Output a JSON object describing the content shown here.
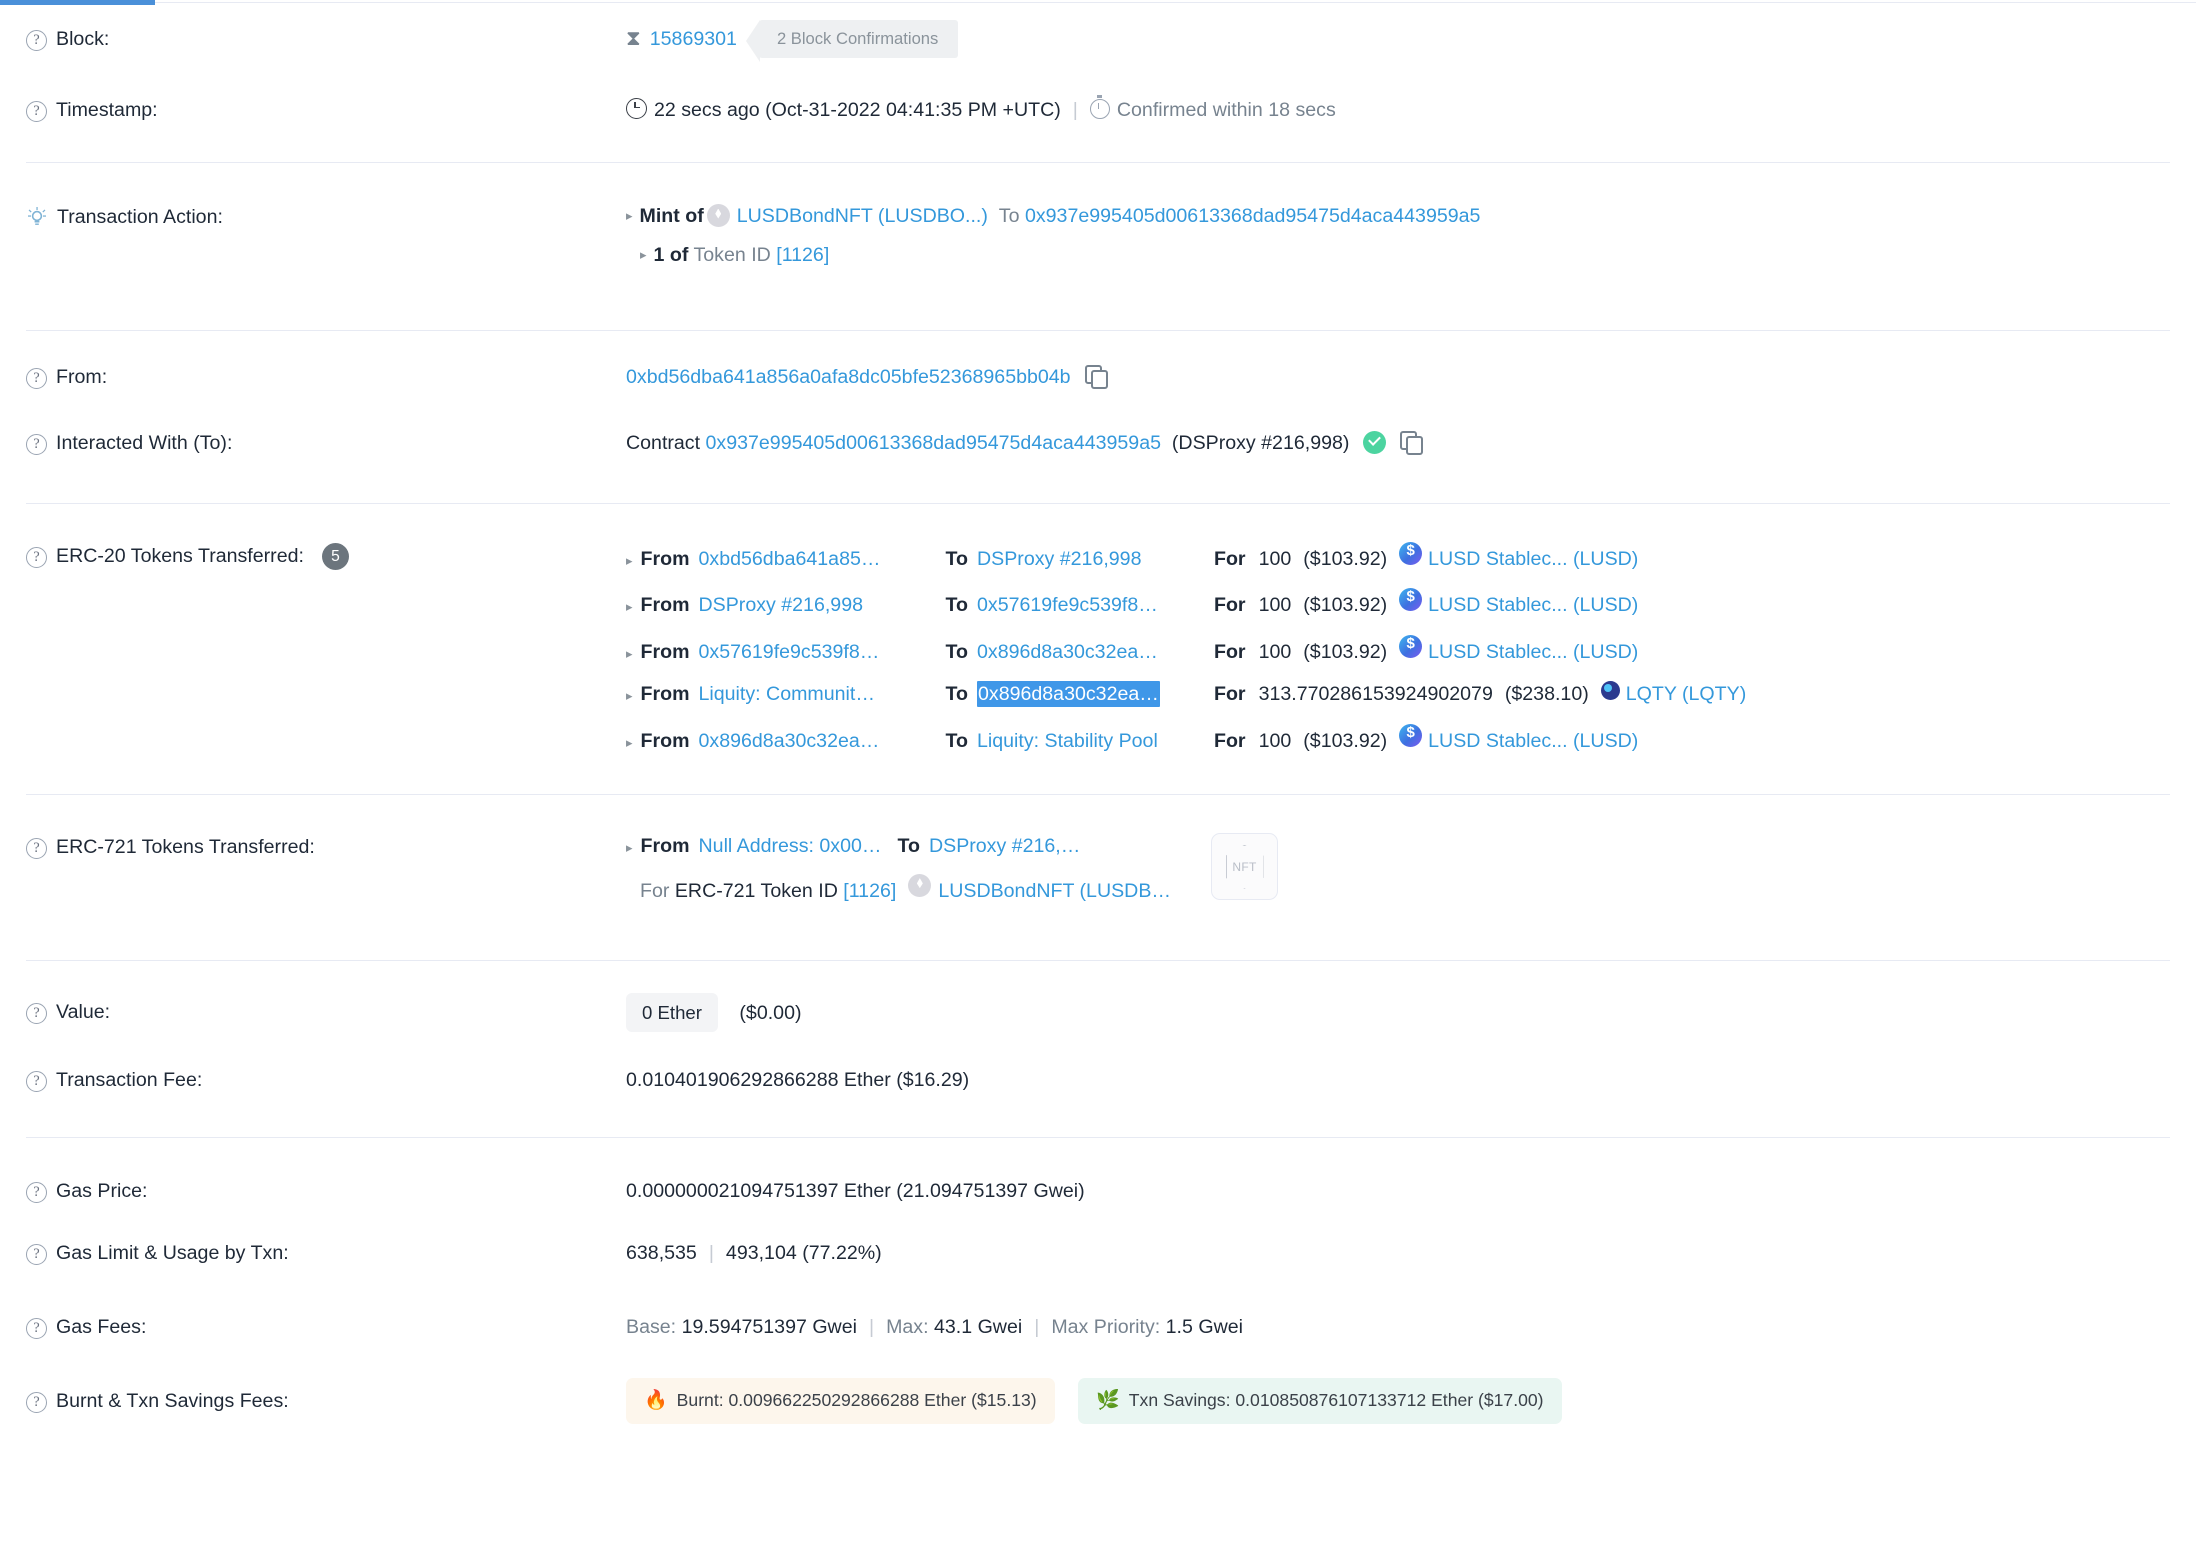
{
  "rows": {
    "block": {
      "label": "Block:",
      "number": "15869301",
      "confirmations": "2 Block Confirmations"
    },
    "timestamp": {
      "label": "Timestamp:",
      "value": "22 secs ago (Oct-31-2022 04:41:35 PM +UTC)",
      "confirmed": "Confirmed within 18 secs"
    },
    "transaction_action": {
      "label": "Transaction Action:",
      "line1_prefix": "Mint of",
      "token": "LUSDBondNFT (LUSDBO...)",
      "to_word": "To",
      "to_address": "0x937e995405d00613368dad95475d4aca443959a5",
      "line2_count": "1 of",
      "line2_label": "Token ID",
      "line2_token_id": "[1126]"
    },
    "from": {
      "label": "From:",
      "address": "0xbd56dba641a856a0afa8dc05bfe52368965bb04b"
    },
    "interacted_with": {
      "label": "Interacted With (To):",
      "prefix": "Contract",
      "address": "0x937e995405d00613368dad95475d4aca443959a5",
      "alias": "(DSProxy #216,998)"
    },
    "erc20": {
      "label": "ERC-20 Tokens Transferred:",
      "count": "5",
      "from_word": "From",
      "to_word": "To",
      "for_word": "For",
      "transfers": [
        {
          "from": "0xbd56dba641a85…",
          "to": "DSProxy #216,998",
          "amount": "100",
          "usd": "($103.92)",
          "token": "LUSD Stablec... (LUSD)",
          "token_icon": "lusd-icon",
          "to_selected": false
        },
        {
          "from": "DSProxy #216,998",
          "to": "0x57619fe9c539f8…",
          "amount": "100",
          "usd": "($103.92)",
          "token": "LUSD Stablec... (LUSD)",
          "token_icon": "lusd-icon",
          "to_selected": false
        },
        {
          "from": "0x57619fe9c539f8…",
          "to": "0x896d8a30c32ea…",
          "amount": "100",
          "usd": "($103.92)",
          "token": "LUSD Stablec... (LUSD)",
          "token_icon": "lusd-icon",
          "to_selected": false
        },
        {
          "from": "Liquity: Communit…",
          "to": "0x896d8a30c32ea…",
          "amount": "313.770286153924902079",
          "usd": "($238.10)",
          "token": "LQTY (LQTY)",
          "token_icon": "lqty-icon",
          "to_selected": true
        },
        {
          "from": "0x896d8a30c32ea…",
          "to": "Liquity: Stability Pool",
          "amount": "100",
          "usd": "($103.92)",
          "token": "LUSD Stablec... (LUSD)",
          "token_icon": "lusd-icon",
          "to_selected": false
        }
      ]
    },
    "erc721": {
      "label": "ERC-721 Tokens Transferred:",
      "from_word": "From",
      "from_value": "Null Address: 0x00…",
      "to_word": "To",
      "to_value": "DSProxy #216,…",
      "for_word": "For",
      "token_id_label": "ERC-721 Token ID",
      "token_id": "[1126]",
      "token": "LUSDBondNFT (LUSDB…",
      "nft_placeholder": "NFT"
    },
    "value": {
      "label": "Value:",
      "chip": "0 Ether",
      "usd": "($0.00)"
    },
    "transaction_fee": {
      "label": "Transaction Fee:",
      "value": "0.010401906292866288 Ether ($16.29)"
    },
    "gas_price": {
      "label": "Gas Price:",
      "value": "0.000000021094751397 Ether (21.094751397 Gwei)"
    },
    "gas_limit": {
      "label": "Gas Limit & Usage by Txn:",
      "limit": "638,535",
      "usage": "493,104 (77.22%)"
    },
    "gas_fees": {
      "label": "Gas Fees:",
      "base_label": "Base:",
      "base_value": "19.594751397 Gwei",
      "max_label": "Max:",
      "max_value": "43.1 Gwei",
      "max_priority_label": "Max Priority:",
      "max_priority_value": "1.5 Gwei"
    },
    "burnt_savings": {
      "label": "Burnt & Txn Savings Fees:",
      "burnt": "Burnt: 0.009662250292866288 Ether ($15.13)",
      "burnt_emoji": "🔥",
      "savings": "Txn Savings: 0.010850876107133712 Ether ($17.00)",
      "savings_emoji": "🌿"
    }
  },
  "colors": {
    "link": "#3498db",
    "muted": "#77838f",
    "selection": "#3f97e8",
    "accent_tab": "#4a90d9",
    "success": "#4cd4a0"
  }
}
